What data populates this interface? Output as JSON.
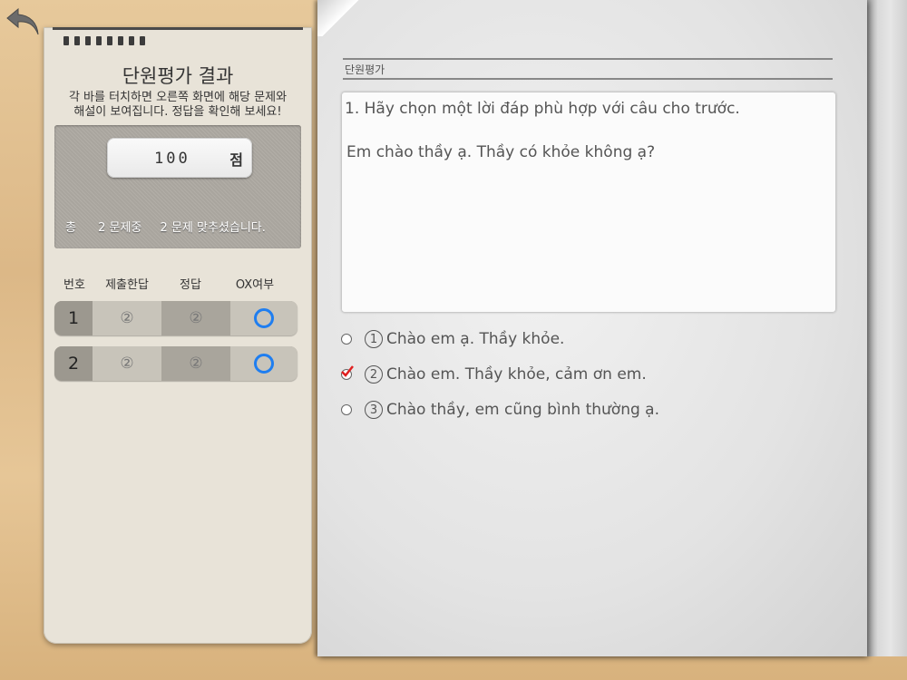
{
  "left": {
    "title": "단원평가 결과",
    "description_line1": "각 바를 터치하면 오른쪽 화면에 해당 문제와",
    "description_line2": "해설이 보여집니다. 정답을 확인해 보세요!",
    "score_value": "100",
    "score_unit": "점",
    "summary": {
      "total_label": "총",
      "total_count": "2 문제중",
      "correct_count": "2 문제 맞추셨습니다."
    },
    "table": {
      "headers": [
        "번호",
        "제출한답",
        "정답",
        "OX여부"
      ],
      "rows": [
        {
          "num": "1",
          "submitted": "②",
          "answer": "②",
          "ox": "O"
        },
        {
          "num": "2",
          "submitted": "②",
          "answer": "②",
          "ox": "O"
        }
      ]
    }
  },
  "book": {
    "section_label": "단원평가",
    "question_text": "1. Hãy chọn một lời đáp phù hợp với câu cho trước.",
    "question_sentence": "Em chào thầy ạ. Thầy có khỏe không ạ?",
    "options": [
      {
        "num": "1",
        "text": "Chào em ạ. Thầy khỏe.",
        "selected": false
      },
      {
        "num": "2",
        "text": "Chào em. Thầy khỏe, cảm ơn em.",
        "selected": true
      },
      {
        "num": "3",
        "text": "Chào thầy, em cũng bình thường ạ.",
        "selected": false
      }
    ]
  },
  "colors": {
    "ox_mark": "#1f7ef0",
    "check_mark": "#e02020"
  },
  "icons": {
    "back": "back-arrow-icon"
  }
}
